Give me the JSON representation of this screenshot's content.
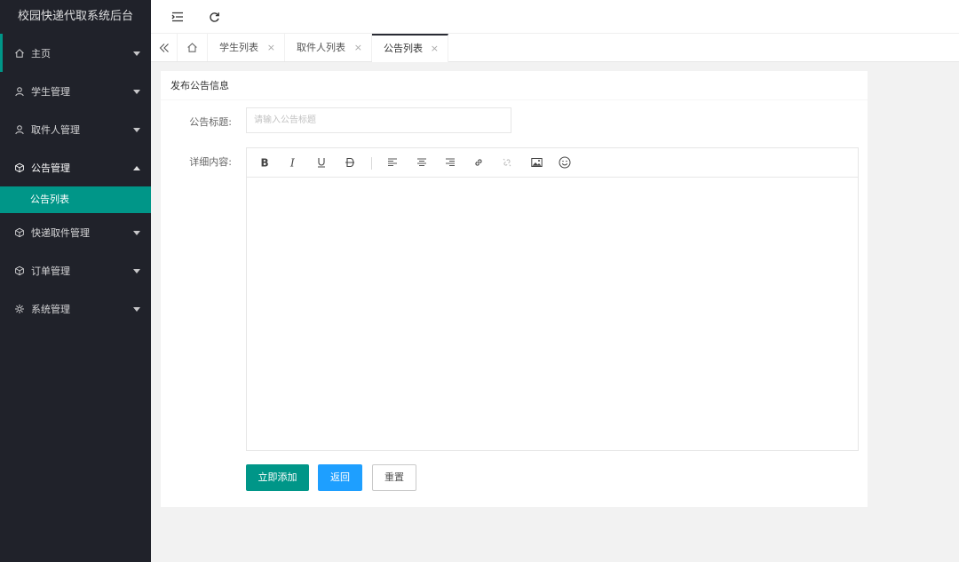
{
  "app": {
    "title": "校园快递代取系统后台"
  },
  "sidebar": {
    "items": [
      {
        "label": "主页",
        "icon": "home-icon"
      },
      {
        "label": "学生管理",
        "icon": "user-icon"
      },
      {
        "label": "取件人管理",
        "icon": "user-icon"
      },
      {
        "label": "公告管理",
        "icon": "cube-icon",
        "expanded": true
      },
      {
        "label": "快递取件管理",
        "icon": "cube-icon"
      },
      {
        "label": "订单管理",
        "icon": "cube-icon"
      },
      {
        "label": "系统管理",
        "icon": "gear-icon"
      }
    ],
    "sub_active": "公告列表"
  },
  "tabs": [
    {
      "label": "学生列表",
      "close": "×"
    },
    {
      "label": "取件人列表",
      "close": "×"
    },
    {
      "label": "公告列表",
      "close": "×",
      "active": true
    }
  ],
  "panel": {
    "title": "发布公告信息",
    "title_label": "公告标题:",
    "title_placeholder": "请输入公告标题",
    "title_value": "",
    "content_label": "详细内容:",
    "toolbar": [
      "bold",
      "italic",
      "underline",
      "strikethrough",
      "align-left",
      "align-center",
      "align-right",
      "link",
      "unlink",
      "image",
      "emoji"
    ],
    "buttons": {
      "add": "立即添加",
      "back": "返回",
      "reset": "重置"
    }
  },
  "colors": {
    "sidebar_bg": "#20222a",
    "accent": "#009688",
    "blue": "#1e9fff"
  }
}
